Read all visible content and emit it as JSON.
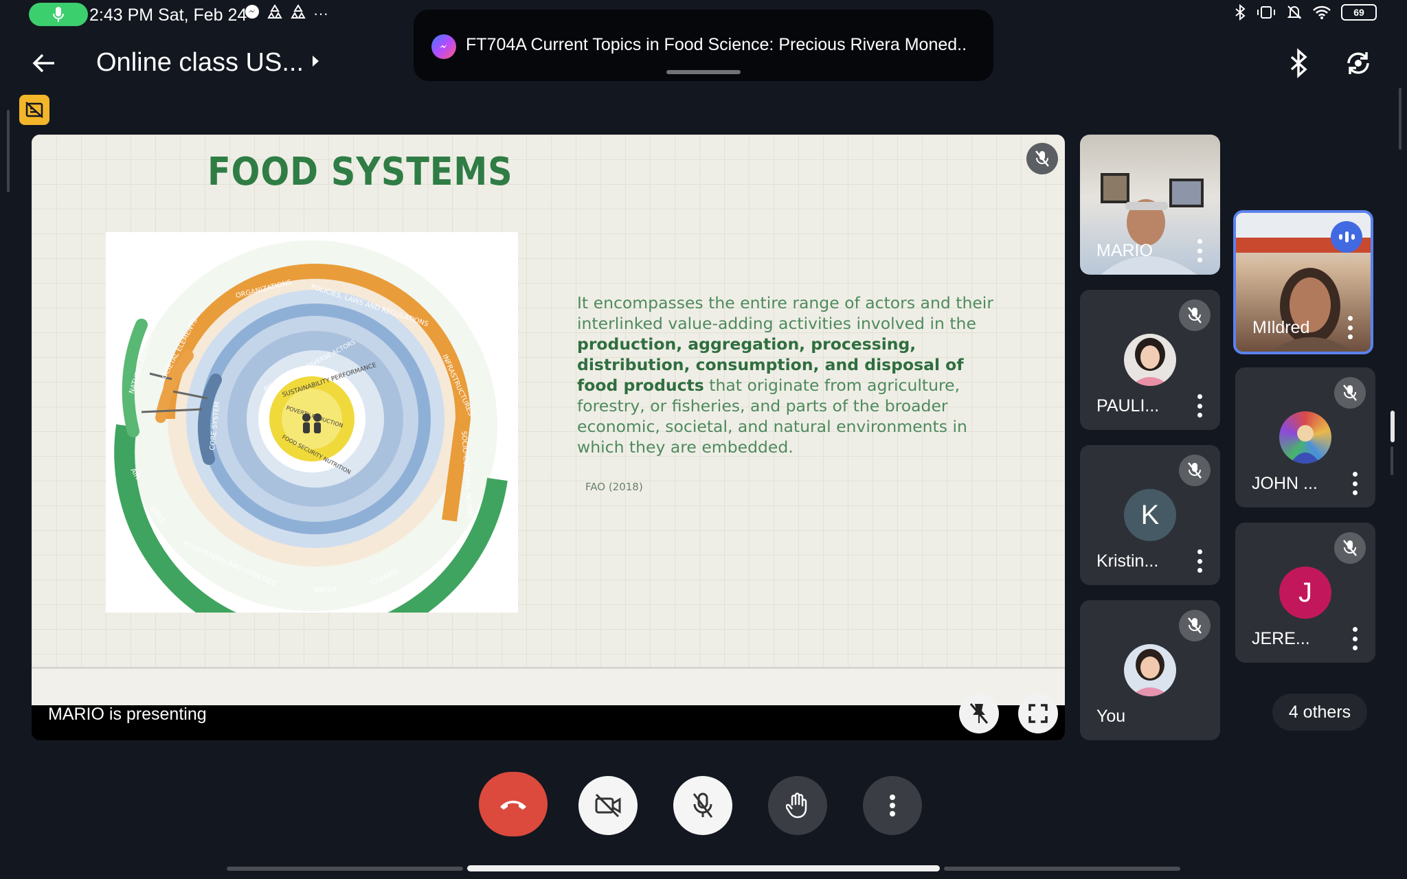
{
  "status_bar": {
    "time_date": "2:43 PM Sat, Feb 24",
    "notification_overflow": "···",
    "battery": "69"
  },
  "notification": {
    "text": "FT704A Current Topics in Food Science: Precious Rivera Moned.."
  },
  "header": {
    "meeting_title": "Online class US..."
  },
  "presentation": {
    "presenting_label": "MARIO is presenting",
    "slide": {
      "title": "FOOD SYSTEMS",
      "body_intro": "It encompasses the entire range of actors and their interlinked value-adding activities involved in the ",
      "body_bold": "production, aggregation, processing, distribution, consumption, and disposal of food products",
      "body_rest": " that originate from agriculture, forestry, or fisheries, and parts of the broader economic, societal, and natural environments in which they are embedded.",
      "citation": "FAO (2018)",
      "diagram_labels": {
        "natural_elements": "NATURAL ELEMENTS",
        "societal_elements": "SOCIETAL ELEMENTS",
        "organizations": "ORGANIZATIONS",
        "policies": "POLICIES, LAWS AND REGULATIONS",
        "infrastructures": "INFRASTRUCTURES",
        "socio_cultural": "SOCIO-CULTURAL NORMS",
        "core_system": "CORE SYSTEM",
        "sustainability": "SUSTAINABILITY PERFORMANCE",
        "poverty": "POVERTY REDUCTION",
        "food_security": "FOOD SECURITY NUTRITION",
        "behaviour": "BEHAVIOUR OF DIVERSE ACTORS",
        "air": "AIR",
        "soils": "SOILS",
        "ecosystems": "ECOSYSTEMS AND GENETICS",
        "water": "WATER",
        "climate": "CLIMATE"
      }
    }
  },
  "participants": [
    {
      "name": "MARIO",
      "type": "video"
    },
    {
      "name": "MIldred",
      "type": "video",
      "speaking": true
    },
    {
      "name": "PAULI...",
      "type": "photo",
      "muted": true
    },
    {
      "name": "JOHN ...",
      "type": "photo",
      "muted": true
    },
    {
      "name": "Kristin...",
      "type": "initial",
      "initial": "K",
      "color": "#455a64",
      "muted": true
    },
    {
      "name": "JERE...",
      "type": "initial",
      "initial": "J",
      "color": "#c2185b",
      "muted": true
    },
    {
      "name": "You",
      "type": "photo",
      "muted": true
    }
  ],
  "others_label": "4 others",
  "colors": {
    "background": "#131720",
    "end_call": "#dc4a3d",
    "speaking": "#4169e1",
    "slide_title": "#2f7d45"
  }
}
